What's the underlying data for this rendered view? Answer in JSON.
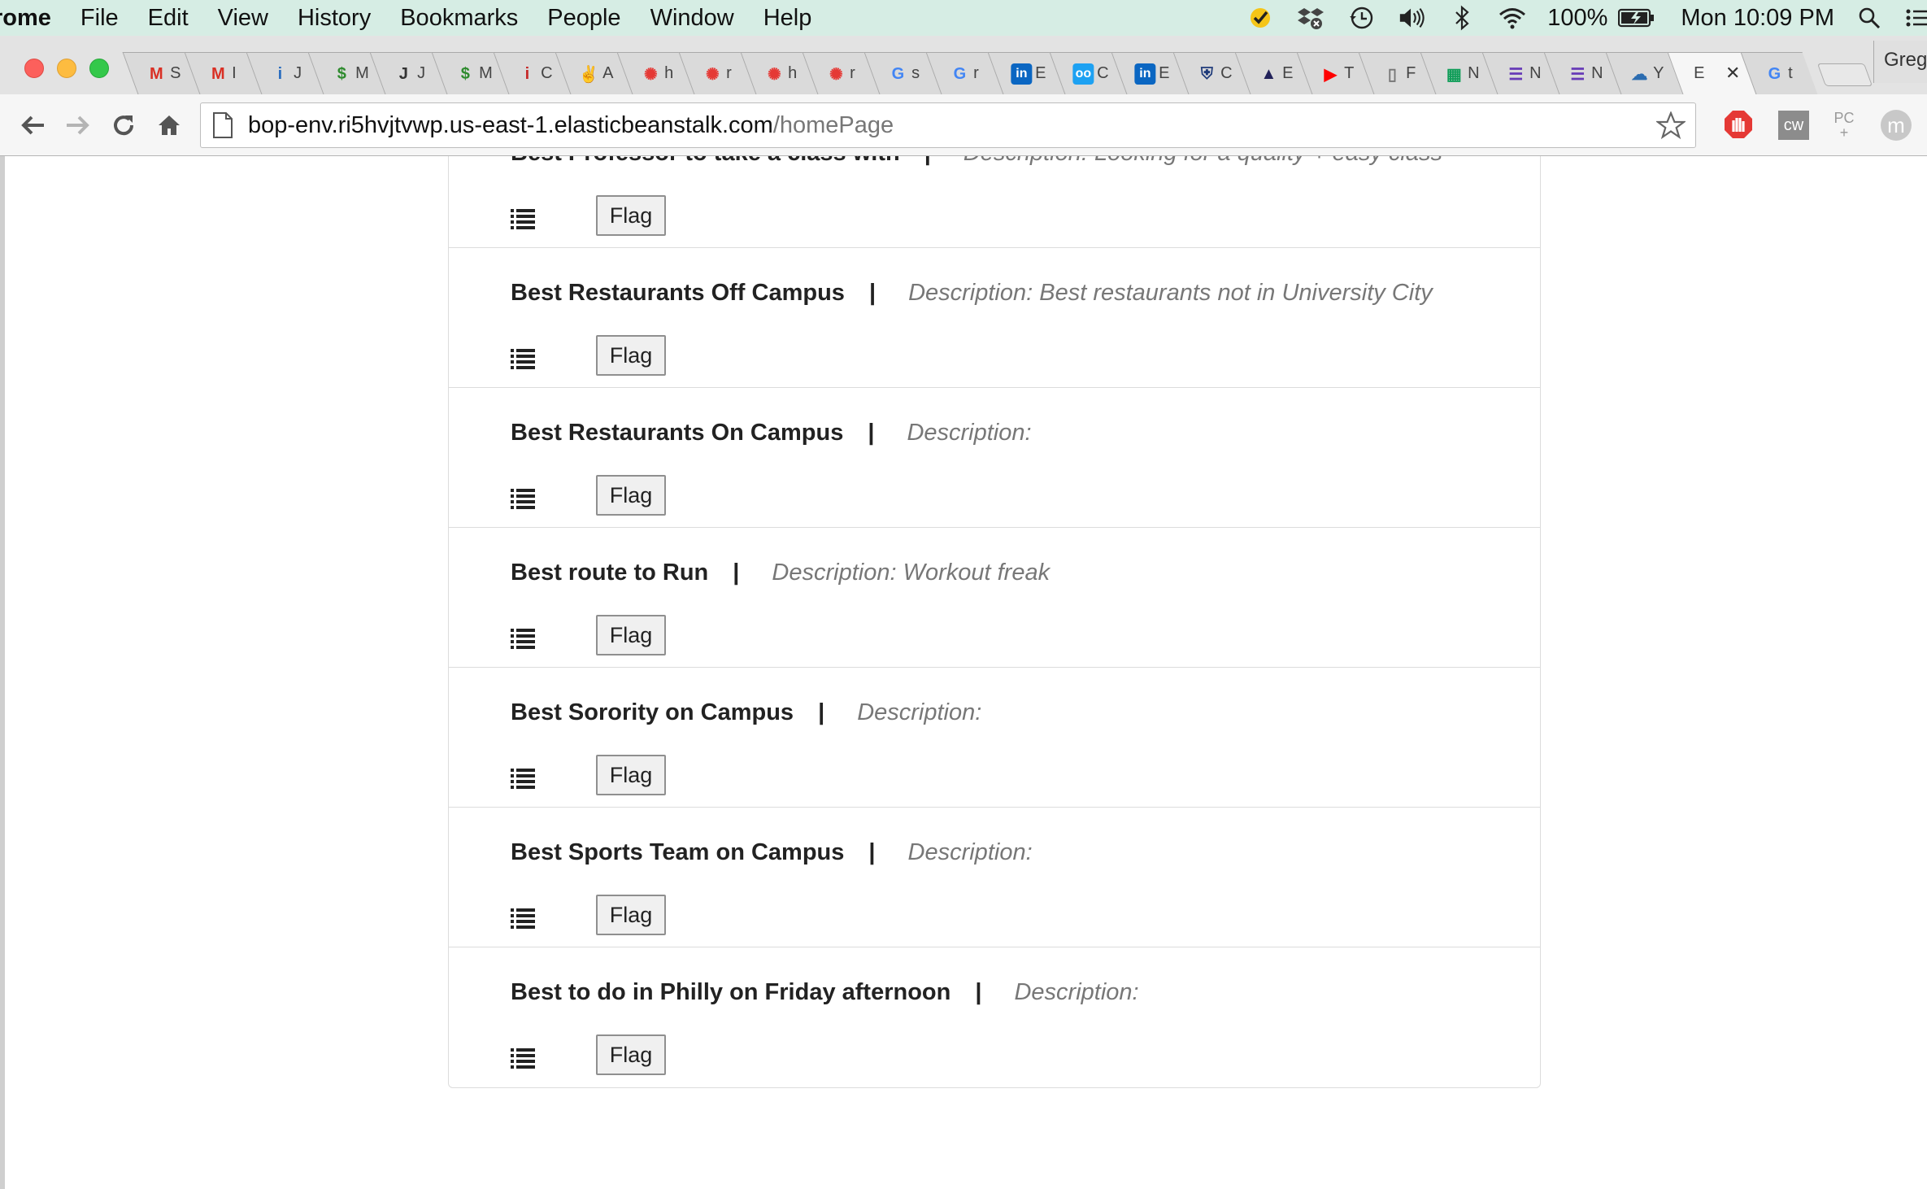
{
  "menubar": {
    "app_name": "rome",
    "items": [
      "File",
      "Edit",
      "View",
      "History",
      "Bookmarks",
      "People",
      "Window",
      "Help"
    ],
    "battery": "100%",
    "clock": "Mon 10:09 PM"
  },
  "tabs": [
    {
      "title": "S",
      "icon": "gmail-icon",
      "color": "#d93025",
      "glyph": "M"
    },
    {
      "title": "I",
      "icon": "gmail-icon",
      "color": "#d93025",
      "glyph": "M"
    },
    {
      "title": "J",
      "icon": "info-icon",
      "color": "#2a6dbf",
      "glyph": "i"
    },
    {
      "title": "M",
      "icon": "map-pin-icon",
      "color": "#2e8b2e",
      "glyph": "$"
    },
    {
      "title": "J",
      "icon": "j-icon",
      "color": "#333333",
      "glyph": "J"
    },
    {
      "title": "M",
      "icon": "map-pin-icon",
      "color": "#2e8b2e",
      "glyph": "$"
    },
    {
      "title": "C",
      "icon": "info-italic-icon",
      "color": "#c62828",
      "glyph": "i"
    },
    {
      "title": "A",
      "icon": "peace-hand-icon",
      "color": "#333333",
      "glyph": "✌"
    },
    {
      "title": "h",
      "icon": "canvas-icon",
      "color": "#e53935",
      "glyph": "✺"
    },
    {
      "title": "r",
      "icon": "canvas-icon",
      "color": "#e53935",
      "glyph": "✺"
    },
    {
      "title": "h",
      "icon": "canvas-icon",
      "color": "#e53935",
      "glyph": "✺"
    },
    {
      "title": "r",
      "icon": "canvas-icon",
      "color": "#e53935",
      "glyph": "✺"
    },
    {
      "title": "s",
      "icon": "google-icon",
      "color": "#4285f4",
      "glyph": "G"
    },
    {
      "title": "r",
      "icon": "google-icon",
      "color": "#4285f4",
      "glyph": "G"
    },
    {
      "title": "E",
      "icon": "linkedin-icon",
      "color": "#0a66c2",
      "glyph": "in"
    },
    {
      "title": "C",
      "icon": "oo-icon",
      "color": "#1da1f2",
      "glyph": "oo"
    },
    {
      "title": "E",
      "icon": "linkedin-icon",
      "color": "#0a66c2",
      "glyph": "in"
    },
    {
      "title": "C",
      "icon": "crest-icon",
      "color": "#1f3b7a",
      "glyph": "⛨"
    },
    {
      "title": "E",
      "icon": "bag-icon",
      "color": "#22225a",
      "glyph": "▲"
    },
    {
      "title": "T",
      "icon": "youtube-icon",
      "color": "#ff0000",
      "glyph": "▶"
    },
    {
      "title": "F",
      "icon": "document-icon",
      "color": "#777777",
      "glyph": "▯"
    },
    {
      "title": "N",
      "icon": "sheets-icon",
      "color": "#0f9d58",
      "glyph": "▦"
    },
    {
      "title": "N",
      "icon": "list-doc-icon",
      "color": "#673ab7",
      "glyph": "☰"
    },
    {
      "title": "N",
      "icon": "list-doc-icon",
      "color": "#673ab7",
      "glyph": "☰"
    },
    {
      "title": "Y",
      "icon": "cloud-icon",
      "color": "#2b6cb0",
      "glyph": "☁"
    }
  ],
  "active_tab": {
    "title": "E"
  },
  "extra_tab": {
    "title": "t",
    "icon": "google-icon",
    "color": "#4285f4",
    "glyph": "G"
  },
  "profile_name": "Greg",
  "address_bar": {
    "domain": "bop-env.ri5hvjtvwp.us-east-1.elasticbeanstalk.com",
    "path": "/homePage"
  },
  "extensions": {
    "cw_label": "cw",
    "pc_label": "PC",
    "m_label": "m"
  },
  "list": {
    "separator": "|",
    "flag_label": "Flag",
    "items": [
      {
        "title": "Best Professor to take a class with",
        "description": "Description: Looking for a quality + easy class"
      },
      {
        "title": "Best Restaurants Off Campus",
        "description": "Description: Best restaurants not in University City"
      },
      {
        "title": "Best Restaurants On Campus",
        "description": "Description:"
      },
      {
        "title": "Best route to Run",
        "description": "Description: Workout freak"
      },
      {
        "title": "Best Sorority on Campus",
        "description": "Description:"
      },
      {
        "title": "Best Sports Team on Campus",
        "description": "Description:"
      },
      {
        "title": "Best to do in Philly on Friday afternoon",
        "description": "Description:"
      }
    ]
  }
}
